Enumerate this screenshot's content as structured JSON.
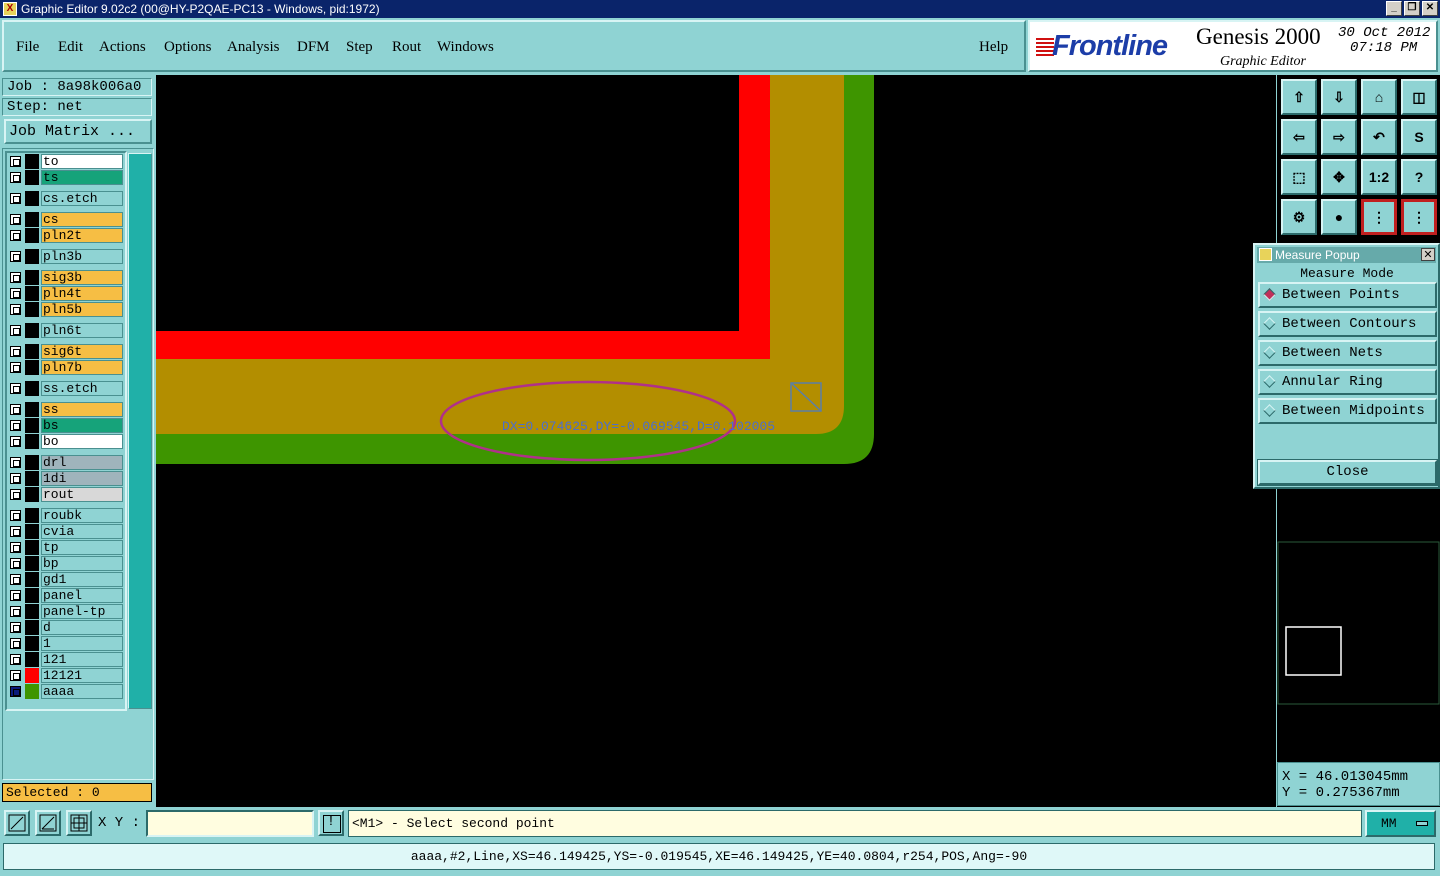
{
  "window": {
    "title": "Graphic Editor 9.02c2 (00@HY-P2QAE-PC13 - Windows, pid:1972)",
    "controls": [
      "_",
      "❐",
      "✕"
    ]
  },
  "menu": [
    "File",
    "Edit",
    "Actions",
    "Options",
    "Analysis",
    "DFM",
    "Step",
    "Rout",
    "Windows"
  ],
  "help_label": "Help",
  "brand": {
    "logo": "Frontline",
    "product": "Genesis 2000",
    "subtitle": "Graphic Editor",
    "date": "30 Oct 2012",
    "time": "07:18 PM"
  },
  "job": {
    "job_label": "Job : 8a98k006a0",
    "step_label": "Step: net",
    "matrix_button": "Job Matrix ..."
  },
  "layers": [
    {
      "name": "to",
      "color": "#ffffff"
    },
    {
      "name": "ts",
      "color": "#16a37a"
    },
    {
      "name": "cs.etch",
      "color": "#8fd3d3"
    },
    {
      "name": "cs",
      "color": "#f6be44"
    },
    {
      "name": "pln2t",
      "color": "#f6be44"
    },
    {
      "name": "pln3b",
      "color": "#8fd3d3"
    },
    {
      "name": "sig3b",
      "color": "#f6be44"
    },
    {
      "name": "pln4t",
      "color": "#f6be44"
    },
    {
      "name": "pln5b",
      "color": "#f6be44"
    },
    {
      "name": "pln6t",
      "color": "#8fd3d3"
    },
    {
      "name": "sig6t",
      "color": "#f6be44"
    },
    {
      "name": "pln7b",
      "color": "#f6be44"
    },
    {
      "name": "ss.etch",
      "color": "#8fd3d3"
    },
    {
      "name": "ss",
      "color": "#f6be44"
    },
    {
      "name": "bs",
      "color": "#16a37a"
    },
    {
      "name": "bo",
      "color": "#ffffff"
    },
    {
      "name": "drl",
      "color": "#9fb4bc"
    },
    {
      "name": "1di",
      "color": "#9fb4bc"
    },
    {
      "name": "rout",
      "color": "#d8d8d8"
    },
    {
      "name": "roubk",
      "color": "#8fd3d3"
    },
    {
      "name": "cvia",
      "color": "#8fd3d3"
    },
    {
      "name": "tp",
      "color": "#8fd3d3"
    },
    {
      "name": "bp",
      "color": "#8fd3d3"
    },
    {
      "name": "gd1",
      "color": "#8fd3d3"
    },
    {
      "name": "panel",
      "color": "#8fd3d3"
    },
    {
      "name": "panel-tp",
      "color": "#8fd3d3"
    },
    {
      "name": "d",
      "color": "#8fd3d3"
    },
    {
      "name": "1",
      "color": "#8fd3d3"
    },
    {
      "name": "121",
      "color": "#8fd3d3"
    },
    {
      "name": "12121",
      "color": "#8fd3d3"
    },
    {
      "name": "aaaa",
      "color": "#8fd3d3"
    }
  ],
  "selected_label": "Selected : 0",
  "measurement": "DX=0.074625,DY=-0.069545,D=0.102005",
  "toolbar_labels": {
    "ratio": "1:2",
    "help": "?"
  },
  "measure_popup": {
    "title": "Measure Popup",
    "mode_label": "Measure Mode",
    "options": [
      "Between Points",
      "Between Contours",
      "Between Nets",
      "Annular Ring",
      "Between Midpoints"
    ],
    "selected": "Between Points",
    "close_label": "Close"
  },
  "coords": {
    "x": "X = 46.013045mm",
    "y": "Y = 0.275367mm"
  },
  "xy_label": "X Y :",
  "xy_value": "",
  "excl_label": "!",
  "prompt": "<M1> - Select second point",
  "units": "MM",
  "status_line": "aaaa,#2,Line,XS=46.149425,YS=-0.019545,XE=46.149425,YE=40.0804,r254,POS,Ang=-90",
  "colors": {
    "red_layer": "#ff0000",
    "gold_layer": "#b38e00",
    "green_layer": "#3e9500",
    "measure_ellipse": "#b0308a"
  }
}
